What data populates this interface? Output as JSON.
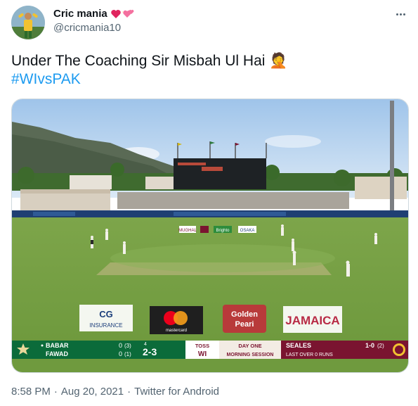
{
  "user": {
    "display_name": "Cric mania",
    "handle": "@cricmania10",
    "avatar_icon": "profile-avatar"
  },
  "tweet": {
    "text": "Under The Coaching Sir Misbah Ul Hai",
    "emoji": "🤦",
    "hashtag": "#WIvsPAK"
  },
  "scene": {
    "ads": [
      "CG",
      "INSURANCE",
      "mastercard",
      "Golden",
      "Peari",
      "JAMAICA"
    ],
    "boundary_boards": [
      "MUGHAL",
      "Brighto",
      "OSAKA"
    ]
  },
  "scoreboard": {
    "batter1": "BABAR",
    "batter1_score": "0",
    "batter1_balls": "(3)",
    "batter2": "FAWAD",
    "batter2_score": "0",
    "batter2_balls": "(1)",
    "over_ball": "4",
    "total": "2-3",
    "toss_label": "TOSS",
    "toss_team": "WI",
    "day": "DAY ONE",
    "session": "MORNING SESSION",
    "bowler": "SEALES",
    "bowler_figures": "1-0",
    "bowler_overs": "(2)",
    "last_over": "LAST OVER  0 RUNS",
    "team_colors": {
      "pak": "#0b6b3a",
      "wi": "#7a1430"
    }
  },
  "meta": {
    "time": "8:58 PM",
    "date": "Aug 20, 2021",
    "source": "Twitter for Android"
  },
  "colors": {
    "link": "#1d9bf0",
    "muted": "#536471"
  }
}
